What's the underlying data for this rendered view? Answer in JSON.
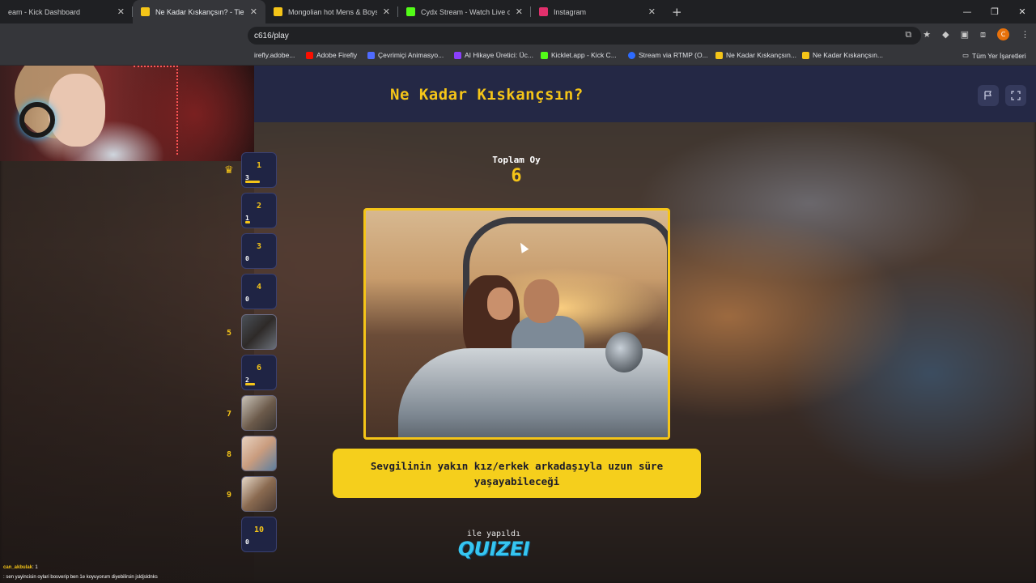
{
  "browser": {
    "tabs": [
      {
        "title": "eam - Kick Dashboard",
        "color": "#53fc18"
      },
      {
        "title": "Ne Kadar Kıskançsın? - Tier List",
        "color": "#f5c518"
      },
      {
        "title": "Mongolian hot Mens & Boys -",
        "color": "#f5c518"
      },
      {
        "title": "Cydx Stream - Watch Live on Ki",
        "color": "#53fc18"
      },
      {
        "title": "Instagram",
        "color": "#e1306c"
      }
    ],
    "url": "c616/play",
    "bookmarks": [
      {
        "label": "irefly.adobe...",
        "color": "#888888"
      },
      {
        "label": "Adobe Firefly",
        "color": "#fa0f00"
      },
      {
        "label": "Çevrimiçi Animasyo...",
        "color": "#4f6bff"
      },
      {
        "label": "AI Hikaye Üretici: Üc...",
        "color": "#8a3ffc"
      },
      {
        "label": "Kicklet.app - Kick C...",
        "color": "#53fc18"
      },
      {
        "label": "Stream via RTMP (O...",
        "color": "#2d6bff"
      },
      {
        "label": "Ne Kadar Kıskançsın...",
        "color": "#f5c518"
      },
      {
        "label": "Ne Kadar Kıskançsın...",
        "color": "#f5c518"
      }
    ],
    "all_bookmarks": "Tüm Yer İşaretleri",
    "profile_initial": "C"
  },
  "quiz": {
    "title": "Ne Kadar Kıskançsın?",
    "total_label": "Toplam Oy",
    "total_value": "6",
    "caption": "Sevgilinin yakın kız/erkek arkadaşıyla uzun süre yaşayabileceği",
    "made_with": "ile yapıldı",
    "brand": "QUIZEI"
  },
  "ranks": [
    {
      "num": "1",
      "count": "3",
      "fill": 0.5
    },
    {
      "num": "2",
      "count": "1",
      "fill": 0.17
    },
    {
      "num": "3",
      "count": "0",
      "fill": 0
    },
    {
      "num": "4",
      "count": "0",
      "fill": 0
    },
    {
      "num": "5",
      "side_label": "5",
      "image": true
    },
    {
      "num": "6",
      "count": "2",
      "fill": 0.33
    },
    {
      "num": "7",
      "side_label": "7",
      "image": true
    },
    {
      "num": "8",
      "side_label": "8",
      "image": true
    },
    {
      "num": "9",
      "side_label": "9",
      "image": true
    },
    {
      "num": "10",
      "count": "0",
      "fill": 0
    }
  ],
  "chat": [
    {
      "user": "can_akbulak",
      "text": ": 1"
    },
    {
      "user": "",
      "text": ": sen yayincisin oylari bosverip ben 1e koyuyorum diyebilirsin jsldjsldnks"
    }
  ],
  "colors": {
    "accent": "#f5c518",
    "header": "#242845",
    "brand": "#36c5f0"
  }
}
